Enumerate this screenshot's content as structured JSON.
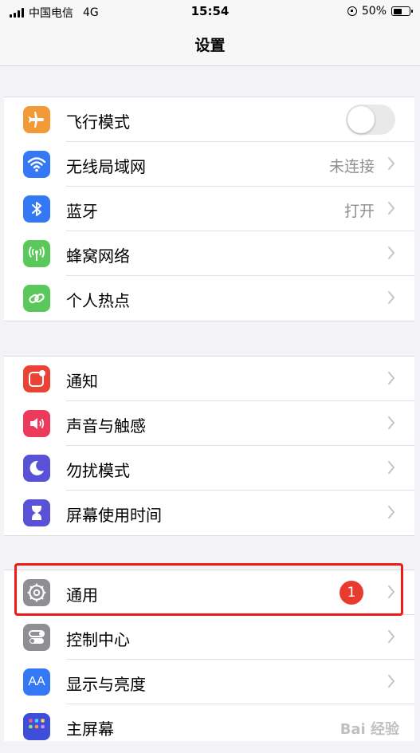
{
  "status_bar": {
    "carrier": "中国电信",
    "network": "4G",
    "time": "15:54",
    "battery": "50%",
    "battery_level": 0.5
  },
  "nav": {
    "title": "设置"
  },
  "groups": [
    {
      "rows": [
        {
          "id": "airplane",
          "label": "飞行模式",
          "icon": "airplane-icon",
          "color": "#f19a37",
          "control": "toggle",
          "toggle_on": false
        },
        {
          "id": "wifi",
          "label": "无线局域网",
          "icon": "wifi-icon",
          "color": "#3478f6",
          "value": "未连接"
        },
        {
          "id": "bluetooth",
          "label": "蓝牙",
          "icon": "bluetooth-icon",
          "color": "#3478f6",
          "value": "打开"
        },
        {
          "id": "cellular",
          "label": "蜂窝网络",
          "icon": "cellular-icon",
          "color": "#5ac85a"
        },
        {
          "id": "hotspot",
          "label": "个人热点",
          "icon": "hotspot-icon",
          "color": "#5ac85a"
        }
      ]
    },
    {
      "rows": [
        {
          "id": "notifications",
          "label": "通知",
          "icon": "notification-icon",
          "color": "#ea4335"
        },
        {
          "id": "sounds",
          "label": "声音与触感",
          "icon": "speaker-icon",
          "color": "#ec3a5c"
        },
        {
          "id": "dnd",
          "label": "勿扰模式",
          "icon": "moon-icon",
          "color": "#5a52d6"
        },
        {
          "id": "screentime",
          "label": "屏幕使用时间",
          "icon": "hourglass-icon",
          "color": "#5a52d6"
        }
      ]
    },
    {
      "rows": [
        {
          "id": "general",
          "label": "通用",
          "icon": "gear-icon",
          "color": "#8e8e93",
          "badge": "1"
        },
        {
          "id": "control_center",
          "label": "控制中心",
          "icon": "switches-icon",
          "color": "#8e8e93"
        },
        {
          "id": "display",
          "label": "显示与亮度",
          "icon": "text-size-icon",
          "color": "#3478f6",
          "icon_text": "AA"
        },
        {
          "id": "home_screen",
          "label": "主屏幕",
          "icon": "grid-icon",
          "color": "#3478f6"
        }
      ]
    }
  ],
  "watermark": "Bai 经验"
}
